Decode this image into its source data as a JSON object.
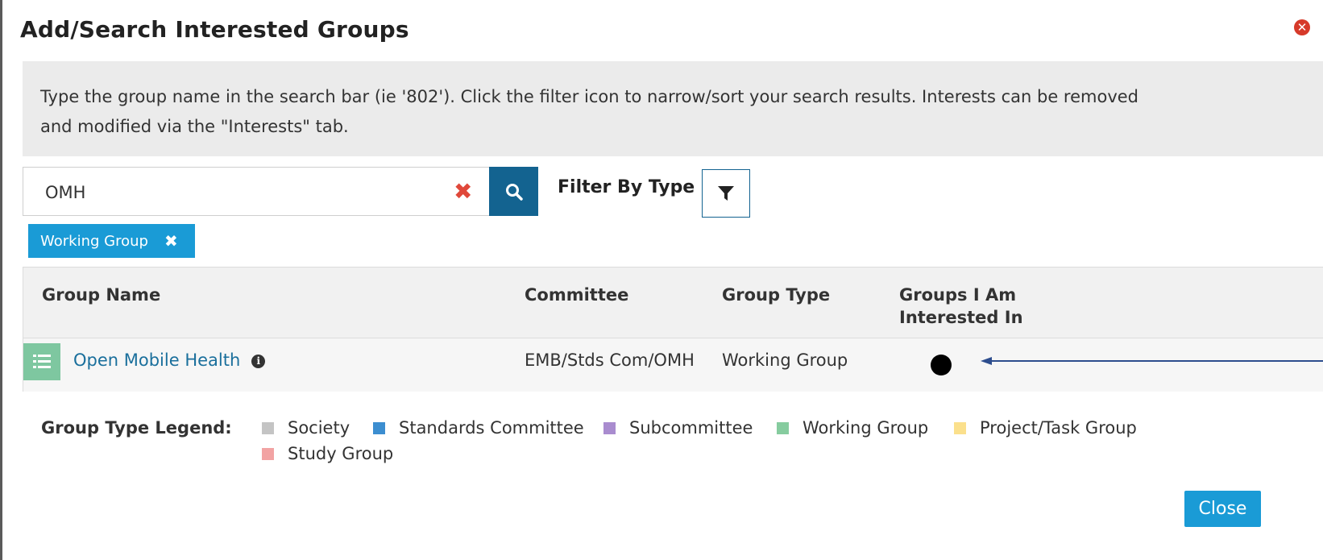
{
  "modal": {
    "title": "Add/Search Interested Groups",
    "close_icon": "close-circle-icon"
  },
  "instructions": {
    "line1": "Type the group name in the search bar (ie '802'). Click the filter icon to narrow/sort your search results. Interests can be removed",
    "line2": "and modified via the \"Interests\" tab."
  },
  "search": {
    "value": "OMH",
    "clear_icon": "clear-x-icon",
    "button_icon": "search-icon"
  },
  "filter": {
    "label": "Filter By Type",
    "icon": "filter-funnel-icon"
  },
  "active_filter_chip": {
    "label": "Working Group",
    "remove_icon": "remove-x-icon"
  },
  "table": {
    "headers": {
      "group_name": "Group Name",
      "committee": "Committee",
      "group_type": "Group Type",
      "interested_line1": "Groups I Am",
      "interested_line2": "Interested In"
    },
    "rows": [
      {
        "group_name": "Open Mobile Health",
        "committee": "EMB/Stds Com/OMH",
        "group_type": "Working Group",
        "row_icon": "list-icon",
        "info_icon": "info-icon"
      }
    ]
  },
  "legend": {
    "label": "Group Type Legend:",
    "items": [
      {
        "label": "Society",
        "color": "#c4c4c4"
      },
      {
        "label": "Standards Committee",
        "color": "#3c8ed0"
      },
      {
        "label": "Subcommittee",
        "color": "#a98ccf"
      },
      {
        "label": "Working Group",
        "color": "#86cc9f"
      },
      {
        "label": "Project/Task Group",
        "color": "#fbe08c"
      },
      {
        "label": "Study Group",
        "color": "#f2a3a3"
      }
    ]
  },
  "footer": {
    "close_label": "Close"
  },
  "colors": {
    "primary": "#136390",
    "accent": "#1a9bd6",
    "danger": "#e0483a"
  }
}
